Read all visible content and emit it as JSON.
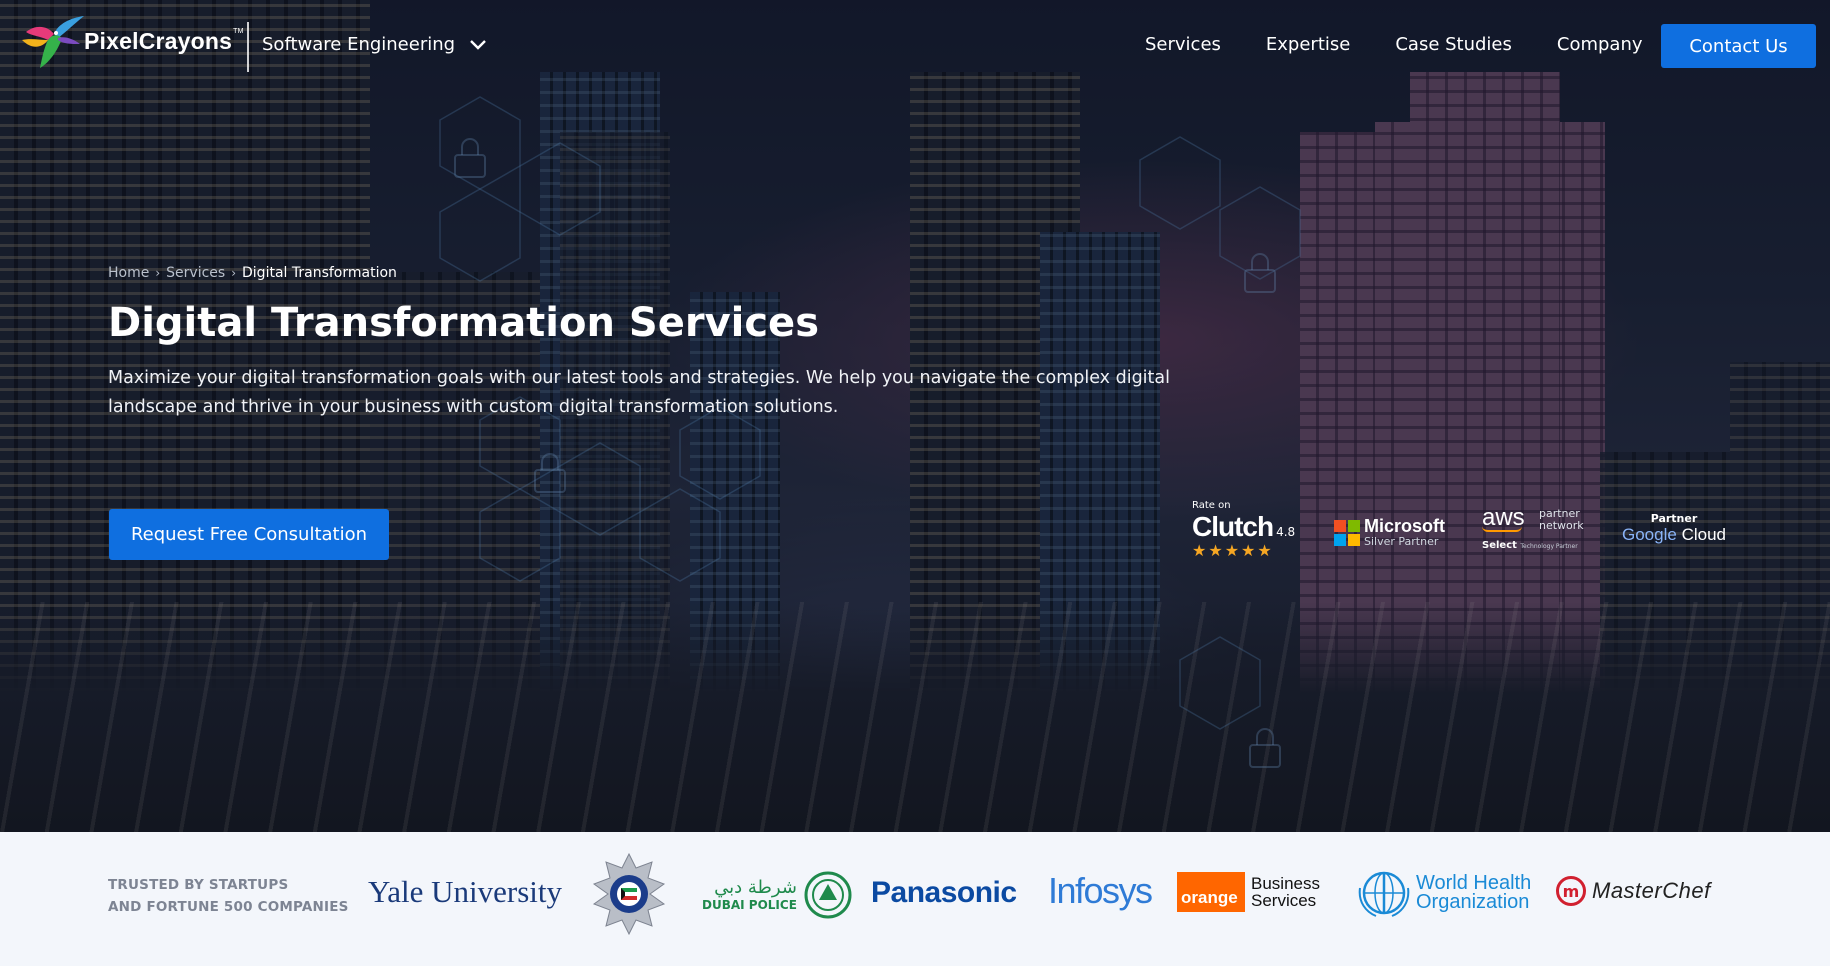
{
  "header": {
    "brand": "PixelCrayons",
    "trademark": "TM",
    "sector_label": "Software Engineering",
    "nav": [
      {
        "label": "Services"
      },
      {
        "label": "Expertise"
      },
      {
        "label": "Case Studies"
      },
      {
        "label": "Company"
      }
    ],
    "contact_label": "Contact Us"
  },
  "hero": {
    "breadcrumb": {
      "home": "Home",
      "services": "Services",
      "current": "Digital Transformation"
    },
    "title": "Digital Transformation Services",
    "description": "Maximize your digital transformation goals with our latest tools and strategies. We help you navigate the complex digital landscape and thrive in your business with custom digital transformation solutions.",
    "cta_label": "Request Free Consultation"
  },
  "badges": {
    "clutch": {
      "rate": "Rate on",
      "name": "Clutch",
      "score": "4.8",
      "stars": "★★★★★"
    },
    "microsoft": {
      "name": "Microsoft",
      "tier": "Silver Partner"
    },
    "aws": {
      "name": "aws",
      "line1": "partner",
      "line2": "network",
      "select": "Select",
      "sub": "Technology Partner"
    },
    "google": {
      "partner": "Partner",
      "google": "Google",
      "cloud": "Cloud"
    }
  },
  "trusted": {
    "label_line1": "TRUSTED BY STARTUPS",
    "label_line2": "AND FORTUNE 500 COMPANIES",
    "logos": {
      "yale": "Yale University",
      "dubai_ar": "شرطة دبي",
      "dubai_en": "DUBAI POLICE",
      "panasonic": "Panasonic",
      "infosys": "Infosys",
      "orange": "orange",
      "orange_bs1": "Business",
      "orange_bs2": "Services",
      "who1": "World Health",
      "who2": "Organization",
      "masterchef": "MasterChef"
    }
  },
  "colors": {
    "primary_button": "#0f6fe0",
    "trusted_bg": "#f3f6fb"
  }
}
